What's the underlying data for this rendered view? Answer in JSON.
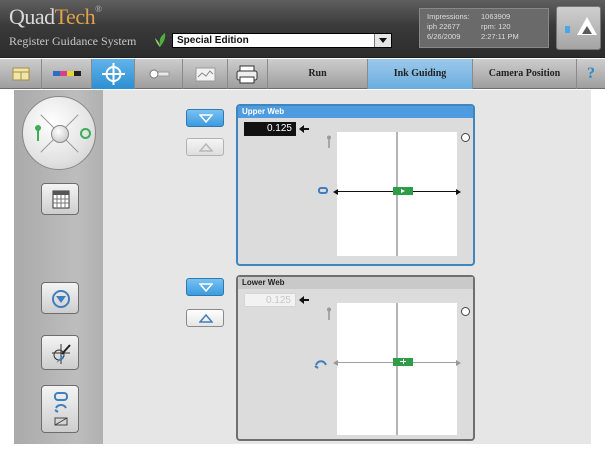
{
  "header": {
    "logo_part1": "Quad",
    "logo_part2": "Tech",
    "logo_mark": "®",
    "subtitle": "Register Guidance System",
    "edition_select_value": "Special Edition",
    "stats": {
      "impressions_label": "Impressions:",
      "impressions_value": "1063909",
      "iph": "iph 22677",
      "rpm": "rpm: 120",
      "date": "6/26/2009",
      "time": "2:27:11 PM"
    },
    "eject_icon": "eject-icon"
  },
  "toolbar": {
    "icons": [
      "calculator-icon",
      "color-bars-icon",
      "crosshair-icon",
      "slider-icon",
      "chart-icon",
      "printer-icon"
    ],
    "tabs": [
      {
        "label": "Run"
      },
      {
        "label": "Ink Guiding"
      },
      {
        "label": "Camera Position"
      }
    ],
    "active_tab": "Ink Guiding",
    "help_label": "?"
  },
  "sidebar": {
    "icons": [
      "direction-dial-icon",
      "calendar-icon",
      "target-icon",
      "brush-icon",
      "link-icon"
    ]
  },
  "upper_web": {
    "title": "Upper Web",
    "value": "0.125"
  },
  "lower_web": {
    "title": "Lower Web",
    "value": "0.125"
  },
  "colors": {
    "accent_blue": "#3d9be0",
    "panel_blue": "#4e9be0",
    "marker_green": "#2f9c48",
    "logo_orange": "#e2a24a"
  }
}
